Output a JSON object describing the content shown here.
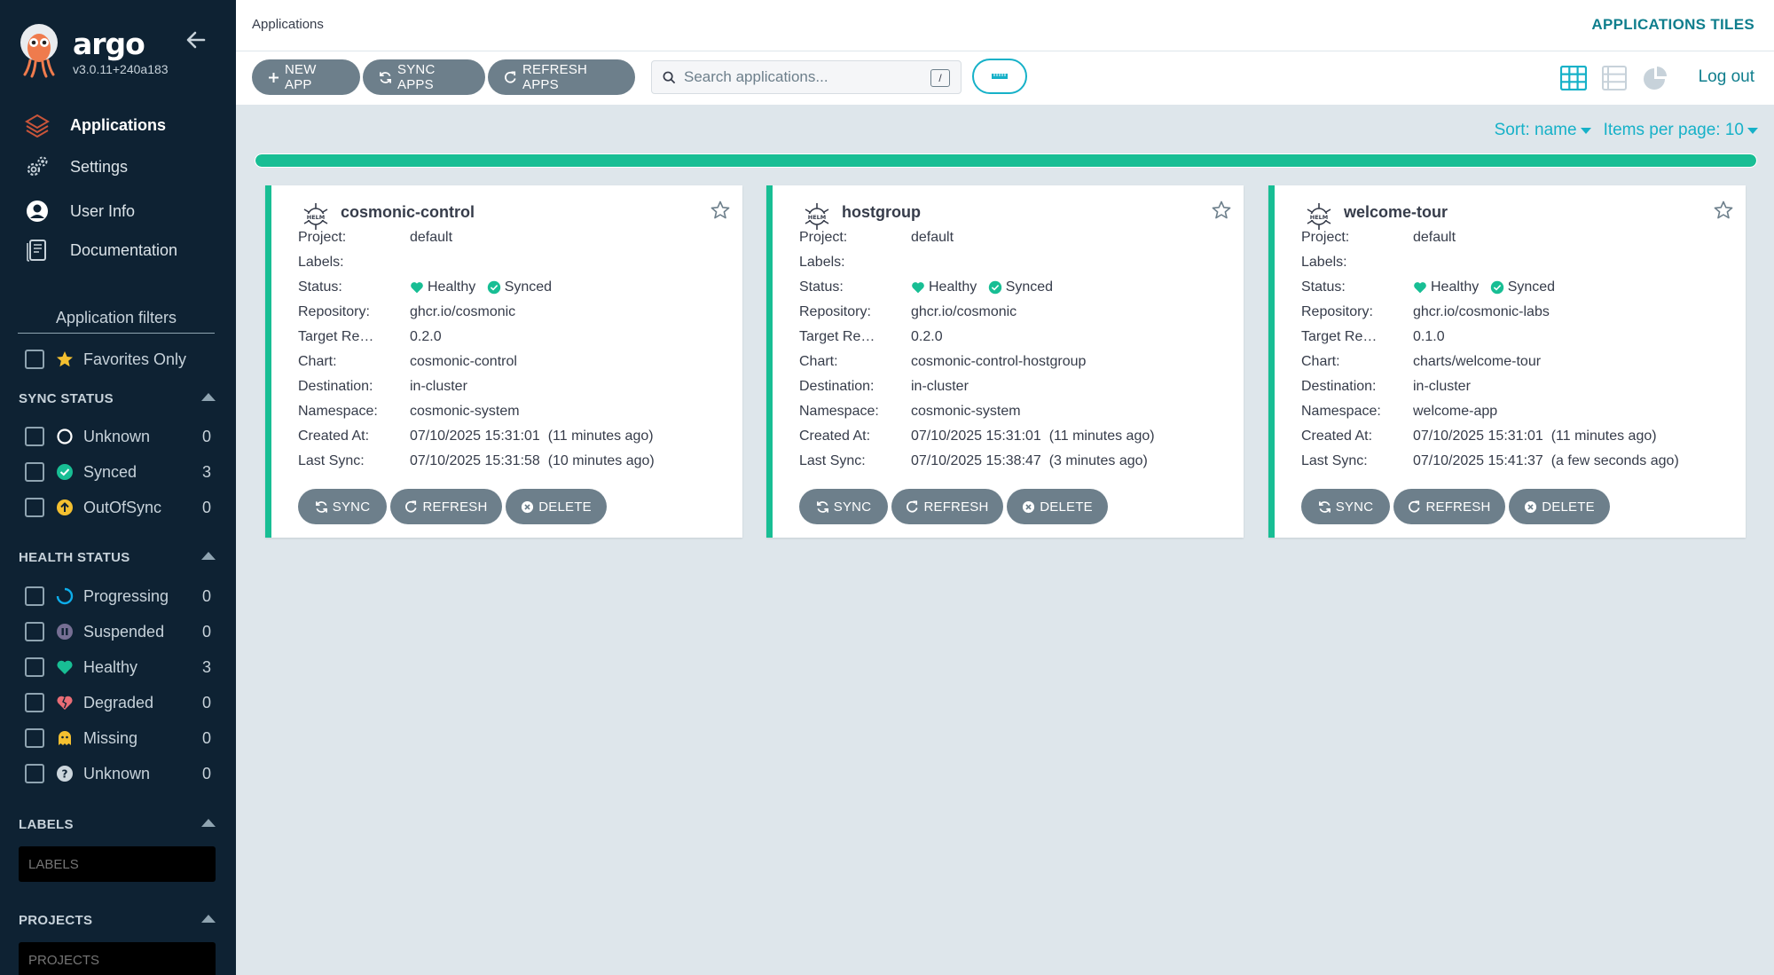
{
  "brand": {
    "name": "argo",
    "version": "v3.0.11+240a183"
  },
  "nav": [
    {
      "label": "Applications",
      "icon": "layers-icon",
      "active": true
    },
    {
      "label": "Settings",
      "icon": "gears-icon"
    },
    {
      "label": "User Info",
      "icon": "user-circle-icon"
    },
    {
      "label": "Documentation",
      "icon": "book-icon"
    }
  ],
  "filters": {
    "title": "Application filters",
    "favorites_label": "Favorites Only",
    "sync_status": {
      "heading": "SYNC STATUS",
      "items": [
        {
          "label": "Unknown",
          "count": "0",
          "icon": "circle-outline-icon"
        },
        {
          "label": "Synced",
          "count": "3",
          "icon": "check-circle-icon",
          "color": "#18be94"
        },
        {
          "label": "OutOfSync",
          "count": "0",
          "icon": "arrow-up-circle-icon",
          "color": "#f4c030"
        }
      ]
    },
    "health_status": {
      "heading": "HEALTH STATUS",
      "items": [
        {
          "label": "Progressing",
          "count": "0",
          "icon": "spinner-icon",
          "color": "#0dadea"
        },
        {
          "label": "Suspended",
          "count": "0",
          "icon": "pause-circle-icon",
          "color": "#766f94"
        },
        {
          "label": "Healthy",
          "count": "3",
          "icon": "heart-icon",
          "color": "#18be94"
        },
        {
          "label": "Degraded",
          "count": "0",
          "icon": "heart-broken-icon",
          "color": "#e96d76"
        },
        {
          "label": "Missing",
          "count": "0",
          "icon": "ghost-icon",
          "color": "#f4c030"
        },
        {
          "label": "Unknown",
          "count": "0",
          "icon": "question-circle-icon",
          "color": "#ccd6dd"
        }
      ]
    },
    "labels": {
      "heading": "LABELS",
      "placeholder": "LABELS"
    },
    "projects": {
      "heading": "PROJECTS",
      "placeholder": "PROJECTS"
    }
  },
  "topbar": {
    "breadcrumb": "Applications",
    "title": "APPLICATIONS TILES"
  },
  "toolbar": {
    "new_app": "NEW APP",
    "sync_apps": "SYNC APPS",
    "refresh_apps": "REFRESH APPS",
    "search_placeholder": "Search applications...",
    "search_shortcut": "/",
    "logout": "Log out"
  },
  "sort": {
    "sort_label": "Sort: name",
    "per_page_label": "Items per page: 10"
  },
  "progress": {
    "fraction": 1.0,
    "color": "#18be94"
  },
  "labels_text": {
    "project": "Project:",
    "labels": "Labels:",
    "status": "Status:",
    "repository": "Repository:",
    "target_revision": "Target Revi...",
    "chart": "Chart:",
    "destination": "Destination:",
    "namespace": "Namespace:",
    "created_at": "Created At:",
    "last_sync": "Last Sync:",
    "healthy": "Healthy",
    "synced": "Synced",
    "sync_btn": "SYNC",
    "refresh_btn": "REFRESH",
    "delete_btn": "DELETE"
  },
  "apps": [
    {
      "name": "cosmonic-control",
      "project": "default",
      "labels": "",
      "repository": "ghcr.io/cosmonic",
      "target_revision": "0.2.0",
      "chart": "cosmonic-control",
      "destination": "in-cluster",
      "namespace": "cosmonic-system",
      "created_at": "07/10/2025 15:31:01  (11 minutes ago)",
      "last_sync": "07/10/2025 15:31:58  (10 minutes ago)"
    },
    {
      "name": "hostgroup",
      "project": "default",
      "labels": "",
      "repository": "ghcr.io/cosmonic",
      "target_revision": "0.2.0",
      "chart": "cosmonic-control-hostgroup",
      "destination": "in-cluster",
      "namespace": "cosmonic-system",
      "created_at": "07/10/2025 15:31:01  (11 minutes ago)",
      "last_sync": "07/10/2025 15:38:47  (3 minutes ago)"
    },
    {
      "name": "welcome-tour",
      "project": "default",
      "labels": "",
      "repository": "ghcr.io/cosmonic-labs",
      "target_revision": "0.1.0",
      "chart": "charts/welcome-tour",
      "destination": "in-cluster",
      "namespace": "welcome-app",
      "created_at": "07/10/2025 15:31:01  (11 minutes ago)",
      "last_sync": "07/10/2025 15:41:37  (a few seconds ago)"
    }
  ]
}
